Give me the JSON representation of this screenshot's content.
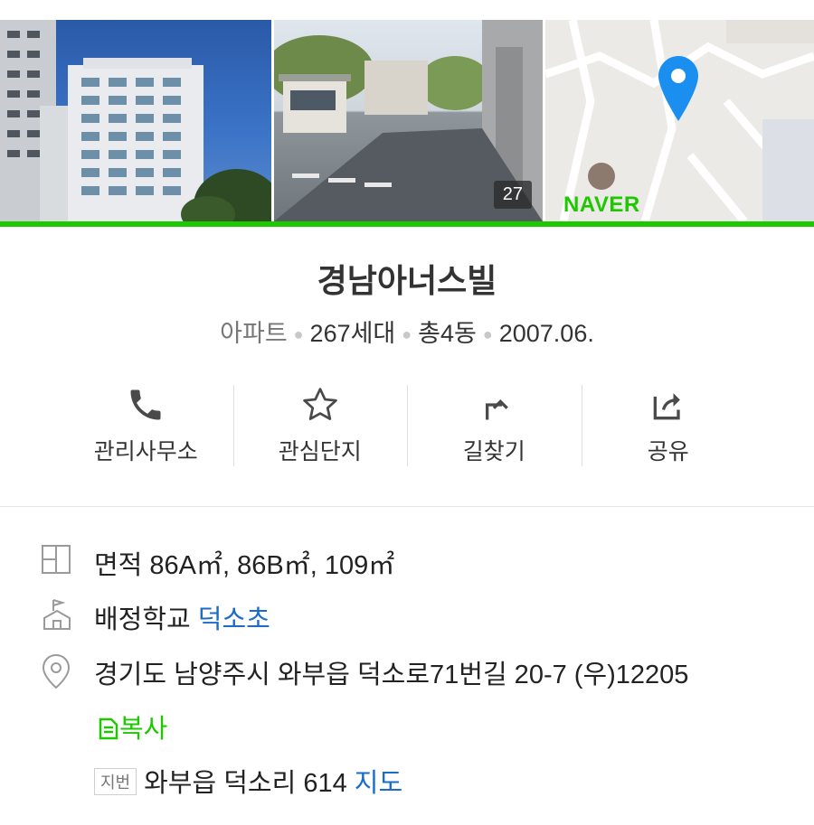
{
  "gallery": {
    "photo_count": "27",
    "map_logo": "NAVER"
  },
  "complex": {
    "name": "경남아너스빌",
    "type": "아파트",
    "households": "267세대",
    "buildings": "총4동",
    "completed": "2007.06."
  },
  "actions": [
    {
      "label": "관리사무소",
      "icon": "phone-icon"
    },
    {
      "label": "관심단지",
      "icon": "star-icon"
    },
    {
      "label": "길찾기",
      "icon": "directions-icon"
    },
    {
      "label": "공유",
      "icon": "share-icon"
    }
  ],
  "info": {
    "area_text": "면적 86A㎡, 86B㎡, 109㎡",
    "school_label": "배정학교",
    "school_name": "덕소초",
    "address": "경기도 남양주시 와부읍 덕소로71번길 20-7 (우)12205",
    "copy_label": "복사",
    "jibun_badge": "지번",
    "jibun_address": "와부읍 덕소리 614",
    "map_link": "지도"
  },
  "colors": {
    "accent_green": "#1ec800",
    "link_blue": "#1a6cc8",
    "map_pin": "#1a8ff0"
  }
}
